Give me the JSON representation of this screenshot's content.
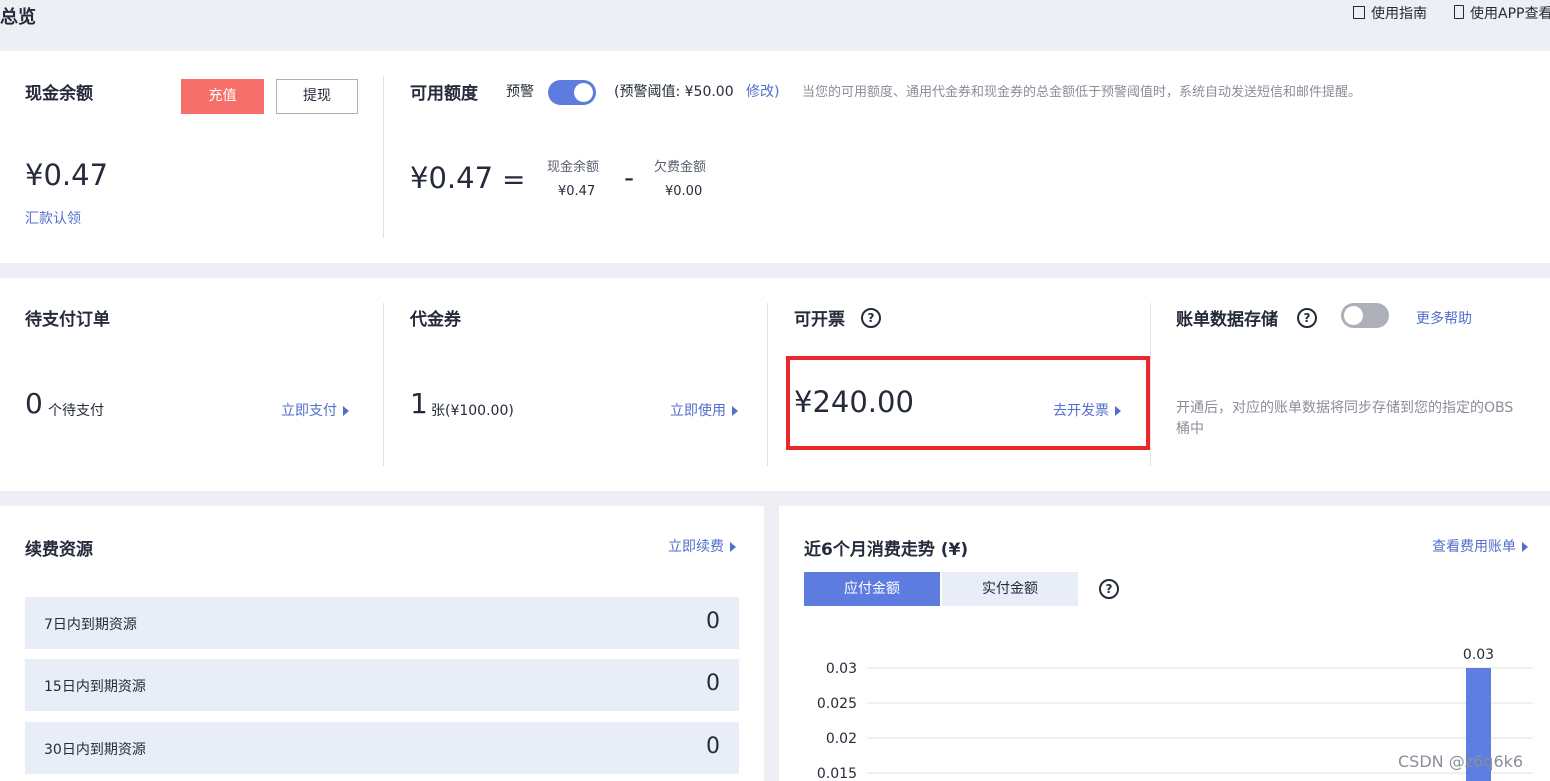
{
  "header": {
    "title": "总览",
    "guide_label": "使用指南",
    "app_label": "使用APP查看"
  },
  "cash": {
    "title": "现金余额",
    "recharge_label": "充值",
    "withdraw_label": "提现",
    "amount": "¥0.47",
    "remit_link": "汇款认领"
  },
  "available": {
    "title": "可用额度",
    "alert_label": "预警",
    "threshold_text": "(预警阈值: ¥50.00",
    "modify_link": "修改)",
    "notice": "当您的可用额度、通用代金券和现金券的总金额低于预警阈值时，系统自动发送短信和邮件提醒。",
    "amount": "¥0.47",
    "equals": "=",
    "minus": "-",
    "cash_label": "现金余额",
    "cash_value": "¥0.47",
    "owed_label": "欠费金额",
    "owed_value": "¥0.00"
  },
  "orders": {
    "title": "待支付订单",
    "count": "0",
    "unit": "个待支付",
    "pay_link": "立即支付"
  },
  "coupons": {
    "title": "代金券",
    "count": "1",
    "unit": "张(¥100.00)",
    "use_link": "立即使用"
  },
  "invoice": {
    "title": "可开票",
    "help_icon": "?",
    "amount": "¥240.00",
    "invoice_link": "去开发票"
  },
  "storage": {
    "title": "账单数据存储",
    "help_icon": "?",
    "more_link": "更多帮助",
    "desc": "开通后，对应的账单数据将同步存储到您的指定的OBS桶中"
  },
  "renew": {
    "title": "续费资源",
    "renew_link": "立即续费",
    "rows": [
      {
        "label": "7日内到期资源",
        "value": "0"
      },
      {
        "label": "15日内到期资源",
        "value": "0"
      },
      {
        "label": "30日内到期资源",
        "value": "0"
      }
    ]
  },
  "trend": {
    "title": "近6个月消费走势 (¥)",
    "bill_link": "查看费用账单",
    "tab_payable": "应付金额",
    "tab_actual": "实付金额",
    "help_icon": "?"
  },
  "chart_data": {
    "type": "bar",
    "title": "",
    "xlabel": "",
    "ylabel": "",
    "y_ticks": [
      "0.03",
      "0.025",
      "0.02",
      "0.015"
    ],
    "bar_label": "0.03",
    "values": [
      0.03
    ],
    "color": "#5f7ee1"
  },
  "watermark": "CSDN @z6q6k6",
  "colors": {
    "accent": "#526ecc",
    "recharge": "#f66f6a",
    "toggle_on": "#5e7ce0",
    "toggle_off": "#adb0b8",
    "highlight_box": "#e8282b"
  }
}
